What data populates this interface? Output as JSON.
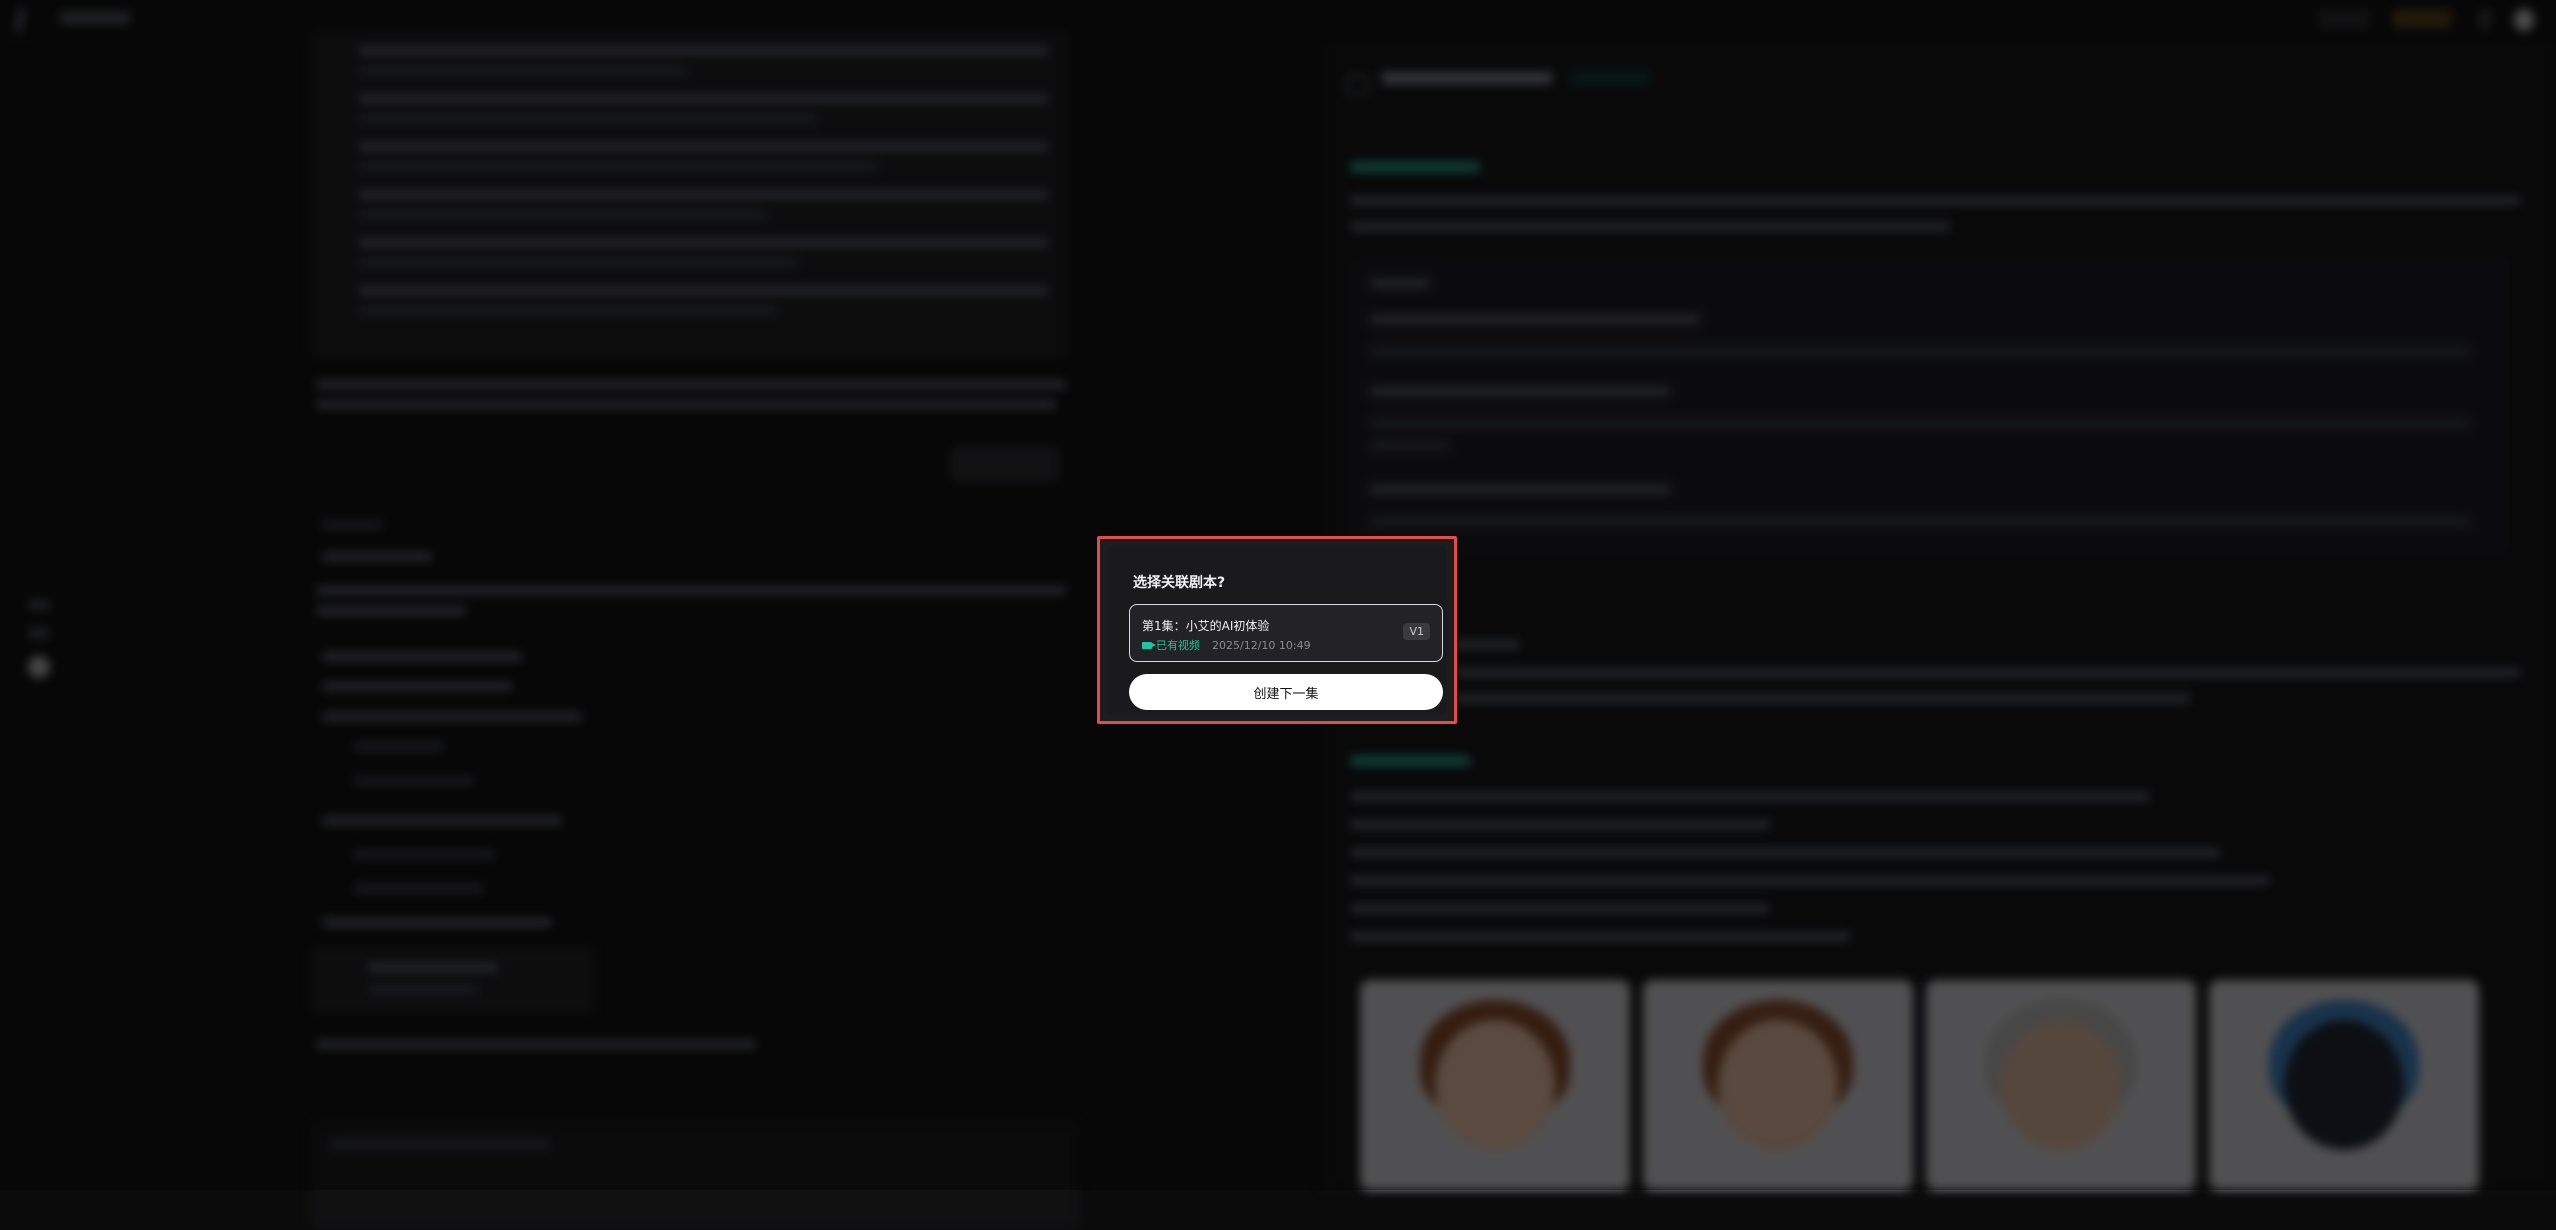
{
  "modal": {
    "title": "选择关联剧本?",
    "script": {
      "title": "第1集：小艾的AI初体验",
      "status": "已有视频",
      "date": "2025/12/10 10:49",
      "version": "V1"
    },
    "create_label": "创建下一集"
  },
  "colors": {
    "highlight": "#e24c4b",
    "accent_green": "#23c2a0",
    "background": "#0b0b0c"
  }
}
